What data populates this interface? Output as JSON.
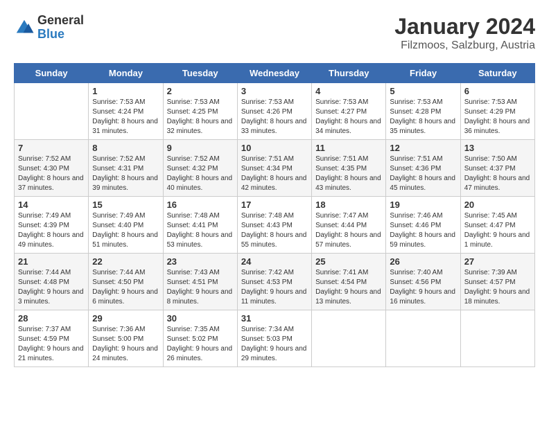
{
  "header": {
    "logo": {
      "general": "General",
      "blue": "Blue"
    },
    "title": "January 2024",
    "location": "Filzmoos, Salzburg, Austria"
  },
  "days_of_week": [
    "Sunday",
    "Monday",
    "Tuesday",
    "Wednesday",
    "Thursday",
    "Friday",
    "Saturday"
  ],
  "weeks": [
    [
      {
        "day": "",
        "sunrise": "",
        "sunset": "",
        "daylight": ""
      },
      {
        "day": "1",
        "sunrise": "Sunrise: 7:53 AM",
        "sunset": "Sunset: 4:24 PM",
        "daylight": "Daylight: 8 hours and 31 minutes."
      },
      {
        "day": "2",
        "sunrise": "Sunrise: 7:53 AM",
        "sunset": "Sunset: 4:25 PM",
        "daylight": "Daylight: 8 hours and 32 minutes."
      },
      {
        "day": "3",
        "sunrise": "Sunrise: 7:53 AM",
        "sunset": "Sunset: 4:26 PM",
        "daylight": "Daylight: 8 hours and 33 minutes."
      },
      {
        "day": "4",
        "sunrise": "Sunrise: 7:53 AM",
        "sunset": "Sunset: 4:27 PM",
        "daylight": "Daylight: 8 hours and 34 minutes."
      },
      {
        "day": "5",
        "sunrise": "Sunrise: 7:53 AM",
        "sunset": "Sunset: 4:28 PM",
        "daylight": "Daylight: 8 hours and 35 minutes."
      },
      {
        "day": "6",
        "sunrise": "Sunrise: 7:53 AM",
        "sunset": "Sunset: 4:29 PM",
        "daylight": "Daylight: 8 hours and 36 minutes."
      }
    ],
    [
      {
        "day": "7",
        "sunrise": "Sunrise: 7:52 AM",
        "sunset": "Sunset: 4:30 PM",
        "daylight": "Daylight: 8 hours and 37 minutes."
      },
      {
        "day": "8",
        "sunrise": "Sunrise: 7:52 AM",
        "sunset": "Sunset: 4:31 PM",
        "daylight": "Daylight: 8 hours and 39 minutes."
      },
      {
        "day": "9",
        "sunrise": "Sunrise: 7:52 AM",
        "sunset": "Sunset: 4:32 PM",
        "daylight": "Daylight: 8 hours and 40 minutes."
      },
      {
        "day": "10",
        "sunrise": "Sunrise: 7:51 AM",
        "sunset": "Sunset: 4:34 PM",
        "daylight": "Daylight: 8 hours and 42 minutes."
      },
      {
        "day": "11",
        "sunrise": "Sunrise: 7:51 AM",
        "sunset": "Sunset: 4:35 PM",
        "daylight": "Daylight: 8 hours and 43 minutes."
      },
      {
        "day": "12",
        "sunrise": "Sunrise: 7:51 AM",
        "sunset": "Sunset: 4:36 PM",
        "daylight": "Daylight: 8 hours and 45 minutes."
      },
      {
        "day": "13",
        "sunrise": "Sunrise: 7:50 AM",
        "sunset": "Sunset: 4:37 PM",
        "daylight": "Daylight: 8 hours and 47 minutes."
      }
    ],
    [
      {
        "day": "14",
        "sunrise": "Sunrise: 7:49 AM",
        "sunset": "Sunset: 4:39 PM",
        "daylight": "Daylight: 8 hours and 49 minutes."
      },
      {
        "day": "15",
        "sunrise": "Sunrise: 7:49 AM",
        "sunset": "Sunset: 4:40 PM",
        "daylight": "Daylight: 8 hours and 51 minutes."
      },
      {
        "day": "16",
        "sunrise": "Sunrise: 7:48 AM",
        "sunset": "Sunset: 4:41 PM",
        "daylight": "Daylight: 8 hours and 53 minutes."
      },
      {
        "day": "17",
        "sunrise": "Sunrise: 7:48 AM",
        "sunset": "Sunset: 4:43 PM",
        "daylight": "Daylight: 8 hours and 55 minutes."
      },
      {
        "day": "18",
        "sunrise": "Sunrise: 7:47 AM",
        "sunset": "Sunset: 4:44 PM",
        "daylight": "Daylight: 8 hours and 57 minutes."
      },
      {
        "day": "19",
        "sunrise": "Sunrise: 7:46 AM",
        "sunset": "Sunset: 4:46 PM",
        "daylight": "Daylight: 8 hours and 59 minutes."
      },
      {
        "day": "20",
        "sunrise": "Sunrise: 7:45 AM",
        "sunset": "Sunset: 4:47 PM",
        "daylight": "Daylight: 9 hours and 1 minute."
      }
    ],
    [
      {
        "day": "21",
        "sunrise": "Sunrise: 7:44 AM",
        "sunset": "Sunset: 4:48 PM",
        "daylight": "Daylight: 9 hours and 3 minutes."
      },
      {
        "day": "22",
        "sunrise": "Sunrise: 7:44 AM",
        "sunset": "Sunset: 4:50 PM",
        "daylight": "Daylight: 9 hours and 6 minutes."
      },
      {
        "day": "23",
        "sunrise": "Sunrise: 7:43 AM",
        "sunset": "Sunset: 4:51 PM",
        "daylight": "Daylight: 9 hours and 8 minutes."
      },
      {
        "day": "24",
        "sunrise": "Sunrise: 7:42 AM",
        "sunset": "Sunset: 4:53 PM",
        "daylight": "Daylight: 9 hours and 11 minutes."
      },
      {
        "day": "25",
        "sunrise": "Sunrise: 7:41 AM",
        "sunset": "Sunset: 4:54 PM",
        "daylight": "Daylight: 9 hours and 13 minutes."
      },
      {
        "day": "26",
        "sunrise": "Sunrise: 7:40 AM",
        "sunset": "Sunset: 4:56 PM",
        "daylight": "Daylight: 9 hours and 16 minutes."
      },
      {
        "day": "27",
        "sunrise": "Sunrise: 7:39 AM",
        "sunset": "Sunset: 4:57 PM",
        "daylight": "Daylight: 9 hours and 18 minutes."
      }
    ],
    [
      {
        "day": "28",
        "sunrise": "Sunrise: 7:37 AM",
        "sunset": "Sunset: 4:59 PM",
        "daylight": "Daylight: 9 hours and 21 minutes."
      },
      {
        "day": "29",
        "sunrise": "Sunrise: 7:36 AM",
        "sunset": "Sunset: 5:00 PM",
        "daylight": "Daylight: 9 hours and 24 minutes."
      },
      {
        "day": "30",
        "sunrise": "Sunrise: 7:35 AM",
        "sunset": "Sunset: 5:02 PM",
        "daylight": "Daylight: 9 hours and 26 minutes."
      },
      {
        "day": "31",
        "sunrise": "Sunrise: 7:34 AM",
        "sunset": "Sunset: 5:03 PM",
        "daylight": "Daylight: 9 hours and 29 minutes."
      },
      {
        "day": "",
        "sunrise": "",
        "sunset": "",
        "daylight": ""
      },
      {
        "day": "",
        "sunrise": "",
        "sunset": "",
        "daylight": ""
      },
      {
        "day": "",
        "sunrise": "",
        "sunset": "",
        "daylight": ""
      }
    ]
  ]
}
